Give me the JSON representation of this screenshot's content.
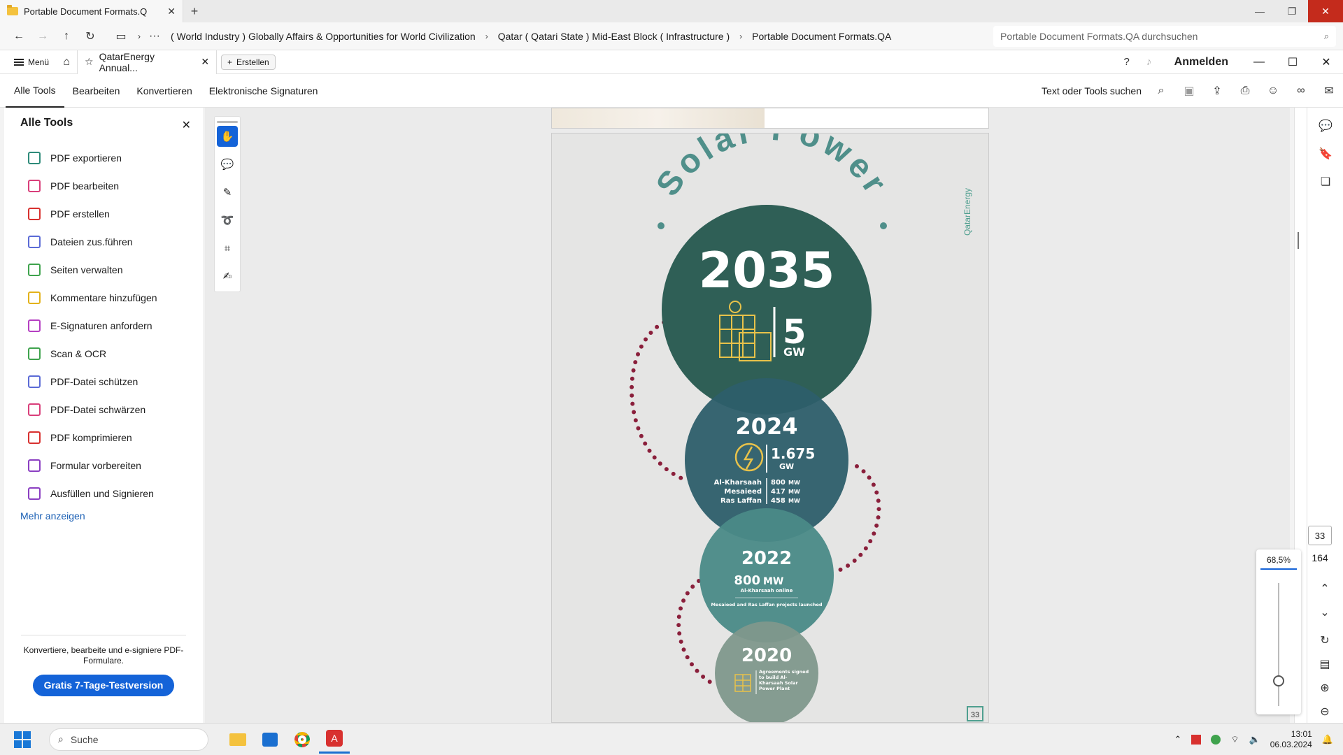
{
  "explorer": {
    "tab_title": "Portable Document Formats.Q",
    "breadcrumbs": [
      "( World Industry ) Globally Affairs & Opportunities for World Civilization",
      "Qatar ( Qatari State ) Mid-East Block ( Infrastructure )",
      "Portable Document Formats.QA"
    ],
    "search_placeholder": "Portable Document Formats.QA durchsuchen"
  },
  "acrobat": {
    "menu_label": "Menü",
    "doc_tab_title": "QatarEnergy Annual...",
    "create_label": "Erstellen",
    "login_label": "Anmelden",
    "tabs": [
      "Alle Tools",
      "Bearbeiten",
      "Konvertieren",
      "Elektronische Signaturen"
    ],
    "find_label": "Text oder Tools suchen"
  },
  "sidebar": {
    "title": "Alle Tools",
    "items": [
      {
        "label": "PDF exportieren",
        "color": "#2e8b7a"
      },
      {
        "label": "PDF bearbeiten",
        "color": "#d93f7a"
      },
      {
        "label": "PDF erstellen",
        "color": "#d8312f"
      },
      {
        "label": "Dateien zus.führen",
        "color": "#5b6bd6"
      },
      {
        "label": "Seiten verwalten",
        "color": "#3fa34d"
      },
      {
        "label": "Kommentare hinzufügen",
        "color": "#e3b21a"
      },
      {
        "label": "E-Signaturen anfordern",
        "color": "#b53fc2"
      },
      {
        "label": "Scan & OCR",
        "color": "#3fa34d"
      },
      {
        "label": "PDF-Datei schützen",
        "color": "#5b6bd6"
      },
      {
        "label": "PDF-Datei schwärzen",
        "color": "#d93f7a"
      },
      {
        "label": "PDF komprimieren",
        "color": "#d8312f"
      },
      {
        "label": "Formular vorbereiten",
        "color": "#8b3fc2"
      },
      {
        "label": "Ausfüllen und Signieren",
        "color": "#8b3fc2"
      }
    ],
    "more_label": "Mehr anzeigen",
    "promo_text": "Konvertiere, bearbeite und e-signiere PDF-Formulare.",
    "promo_button": "Gratis 7-Tage-Testversion"
  },
  "page": {
    "heading": "Solar Power",
    "brand_vertical": "QatarEnergy",
    "page_badge": "33",
    "c2035": {
      "year": "2035",
      "value": "5",
      "unit": "GW"
    },
    "c2024": {
      "year": "2024",
      "value": "1.675",
      "unit": "GW",
      "sites": [
        {
          "name": "Al-Kharsaah",
          "value": "800",
          "unit": "MW"
        },
        {
          "name": "Mesaieed",
          "value": "417",
          "unit": "MW"
        },
        {
          "name": "Ras Laffan",
          "value": "458",
          "unit": "MW"
        }
      ]
    },
    "c2022": {
      "year": "2022",
      "value": "800",
      "unit": "MW",
      "line1": "Al-Kharsaah online",
      "line2": "Mesaieed and Ras Laffan projects launched"
    },
    "c2020": {
      "year": "2020",
      "text": "Agreements signed to build Al-Kharsaah Solar Power Plant"
    }
  },
  "viewer": {
    "current_page": "33",
    "total_pages": "164",
    "zoom": "68,5%"
  },
  "taskbar": {
    "search_label": "Suche",
    "time": "13:01",
    "date": "06.03.2024"
  },
  "colors": {
    "c2035": "#2f5f56",
    "c2024": "#2d5e6a",
    "c2022": "#4a8a87",
    "c2020": "#7f988c",
    "dots": "#8a1f3b",
    "accent": "#1463d8"
  }
}
